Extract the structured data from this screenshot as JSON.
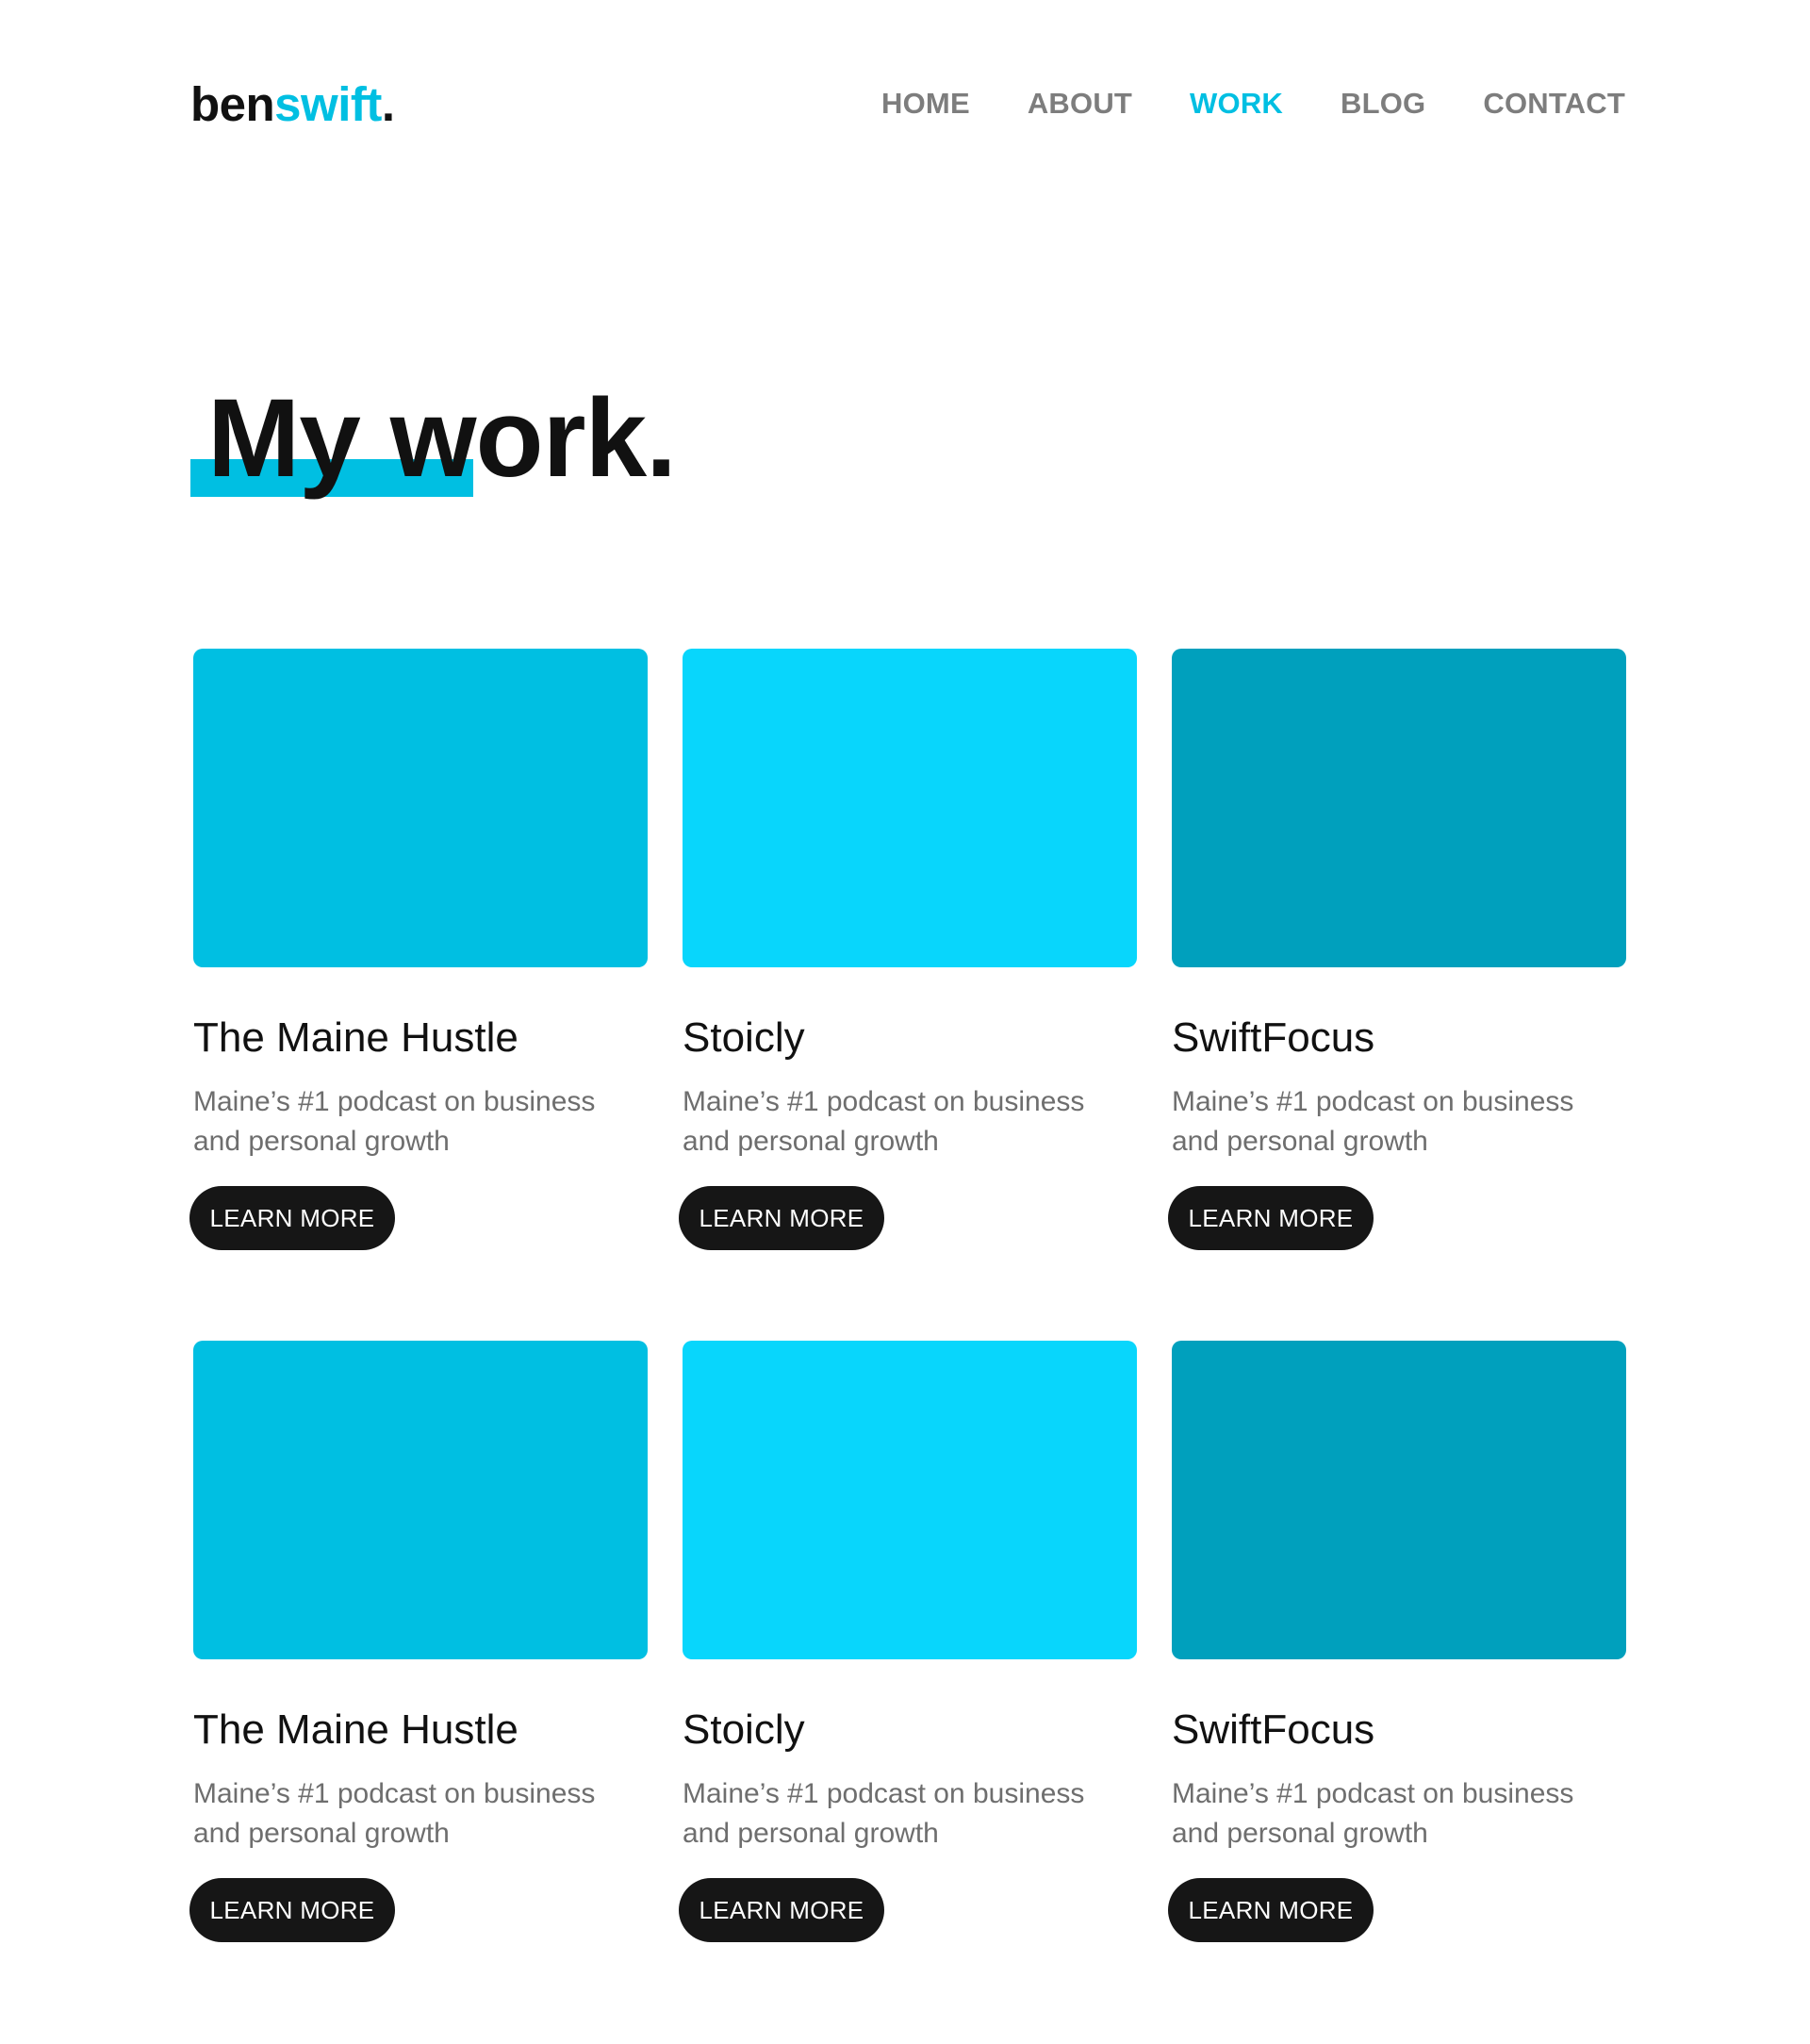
{
  "logo": {
    "part1": "ben",
    "part2": "swift",
    "part3": "."
  },
  "nav": {
    "items": [
      {
        "label": "HOME"
      },
      {
        "label": "ABOUT"
      },
      {
        "label": "WORK"
      },
      {
        "label": "BLOG"
      },
      {
        "label": "CONTACT"
      }
    ],
    "active": "WORK"
  },
  "page": {
    "title": "My work."
  },
  "projects": [
    {
      "title": "The Maine Hustle",
      "description": "Maine’s #1 podcast on business and personal growth",
      "button": "LEARN MORE",
      "color": "#00bfe2"
    },
    {
      "title": "Stoicly",
      "description": "Maine’s #1 podcast on business and personal growth",
      "button": "LEARN MORE",
      "color": "#08d6fc"
    },
    {
      "title": "SwiftFocus",
      "description": "Maine’s #1 podcast on business and personal growth",
      "button": "LEARN MORE",
      "color": "#00a0bd"
    },
    {
      "title": "The Maine Hustle",
      "description": "Maine’s #1 podcast on business and personal growth",
      "button": "LEARN MORE",
      "color": "#00bfe2"
    },
    {
      "title": "Stoicly",
      "description": "Maine’s #1 podcast on business and personal growth",
      "button": "LEARN MORE",
      "color": "#08d6fc"
    },
    {
      "title": "SwiftFocus",
      "description": "Maine’s #1 podcast on business and personal growth",
      "button": "LEARN MORE",
      "color": "#00a0bd"
    }
  ],
  "colors": {
    "accent": "#00bfe2",
    "text": "#111111",
    "muted": "#6e6e6e",
    "nav": "#7d7d7d",
    "button": "#161616"
  }
}
